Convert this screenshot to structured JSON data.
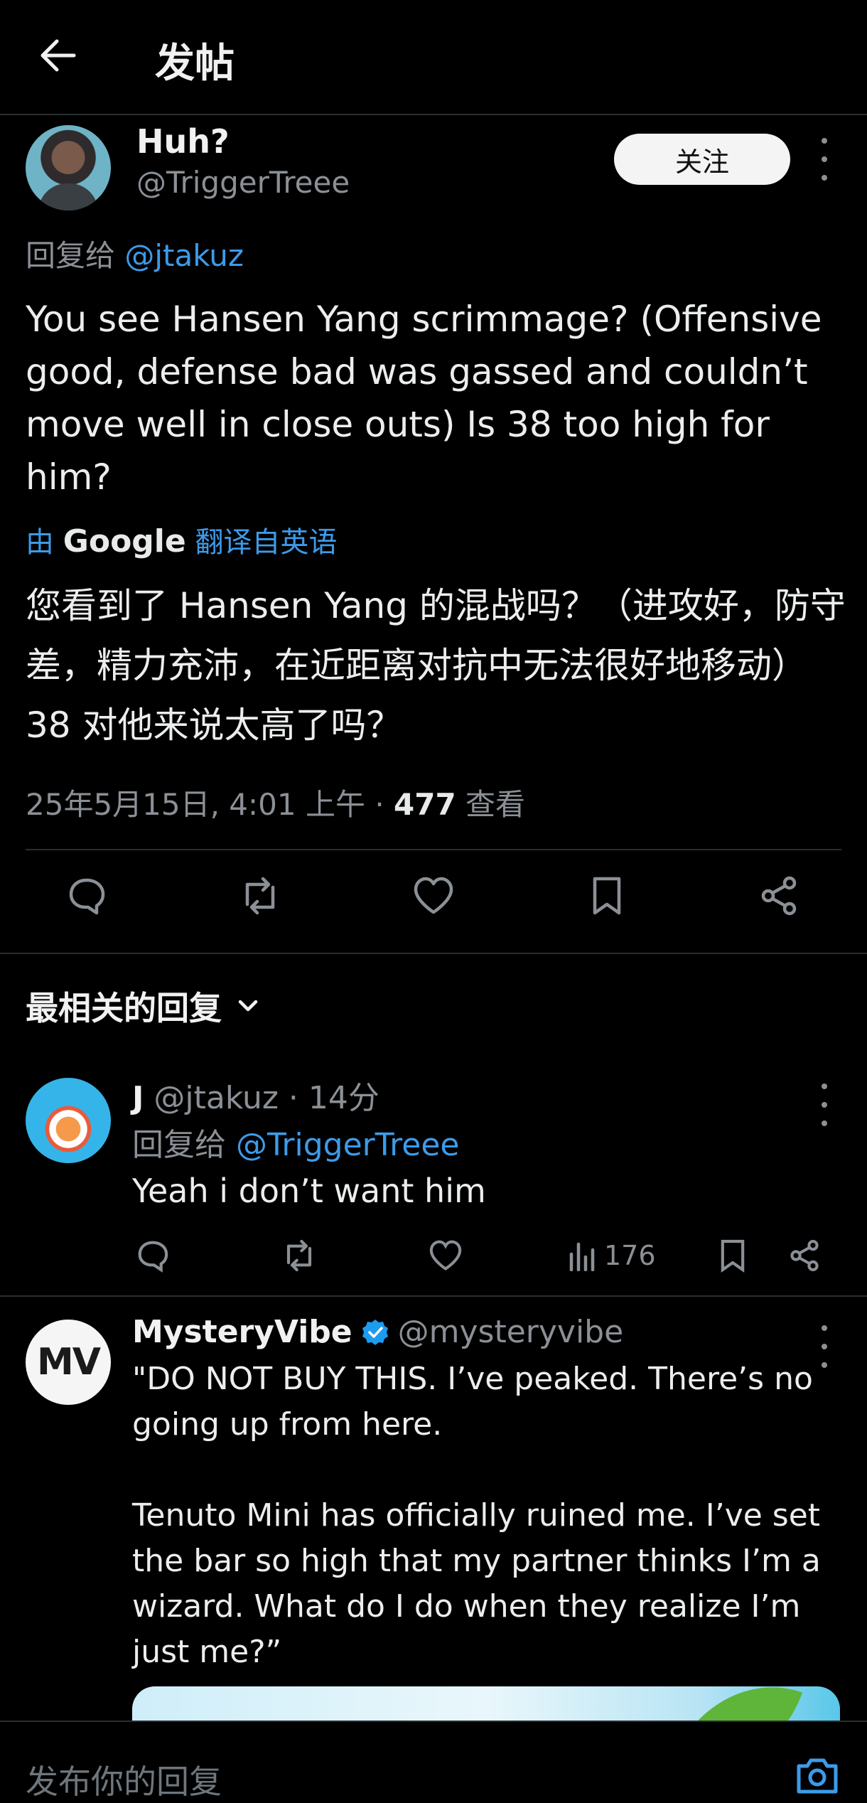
{
  "header": {
    "title": "发帖"
  },
  "post": {
    "author_name": "Huh?",
    "author_handle": "@TriggerTreee",
    "follow_label": "关注",
    "reply_prefix": "回复给",
    "reply_handle": "@jtakuz",
    "text_en": "You see Hansen Yang scrimmage? (Offensive good, defense bad was gassed and couldn’t move well in close outs) Is 38 too high for him?",
    "translate_by": "由",
    "translate_brand": "Google",
    "translate_suffix": "翻译自英语",
    "text_zh": "您看到了 Hansen Yang 的混战吗？（进攻好，防守差，精力充沛，在近距离对抗中无法很好地移动）38 对他来说太高了吗？",
    "timestamp": "25年5月15日, 4:01 上午 · ",
    "views_count": "477",
    "views_label": " 查看",
    "actions": [
      "reply-icon",
      "repost-icon",
      "like-icon",
      "bookmark-icon",
      "share-icon"
    ]
  },
  "sort": {
    "label": "最相关的回复"
  },
  "replies": [
    {
      "name": "J",
      "handle": "@jtakuz",
      "time": " · 14分",
      "reply_prefix": "回复给",
      "reply_handle": "@TriggerTreee",
      "text": "Yeah i don’t want him",
      "views": "176"
    },
    {
      "name": "MysteryVibe",
      "verified": true,
      "handle": "@mysteryvibe",
      "avatar_text": "MV",
      "text": "\"DO NOT BUY THIS. I’ve peaked. There’s no going up from here.\n\nTenuto Mini has officially ruined me. I’ve set the bar so high that my partner thinks I’m a wizard. What do I do when they realize I’m just me?”"
    }
  ],
  "composer": {
    "placeholder": "发布你的回复"
  },
  "colors": {
    "background": "#000000",
    "link": "#3d9be9",
    "muted": "#8b9096",
    "verified": "#1d9bf0"
  }
}
